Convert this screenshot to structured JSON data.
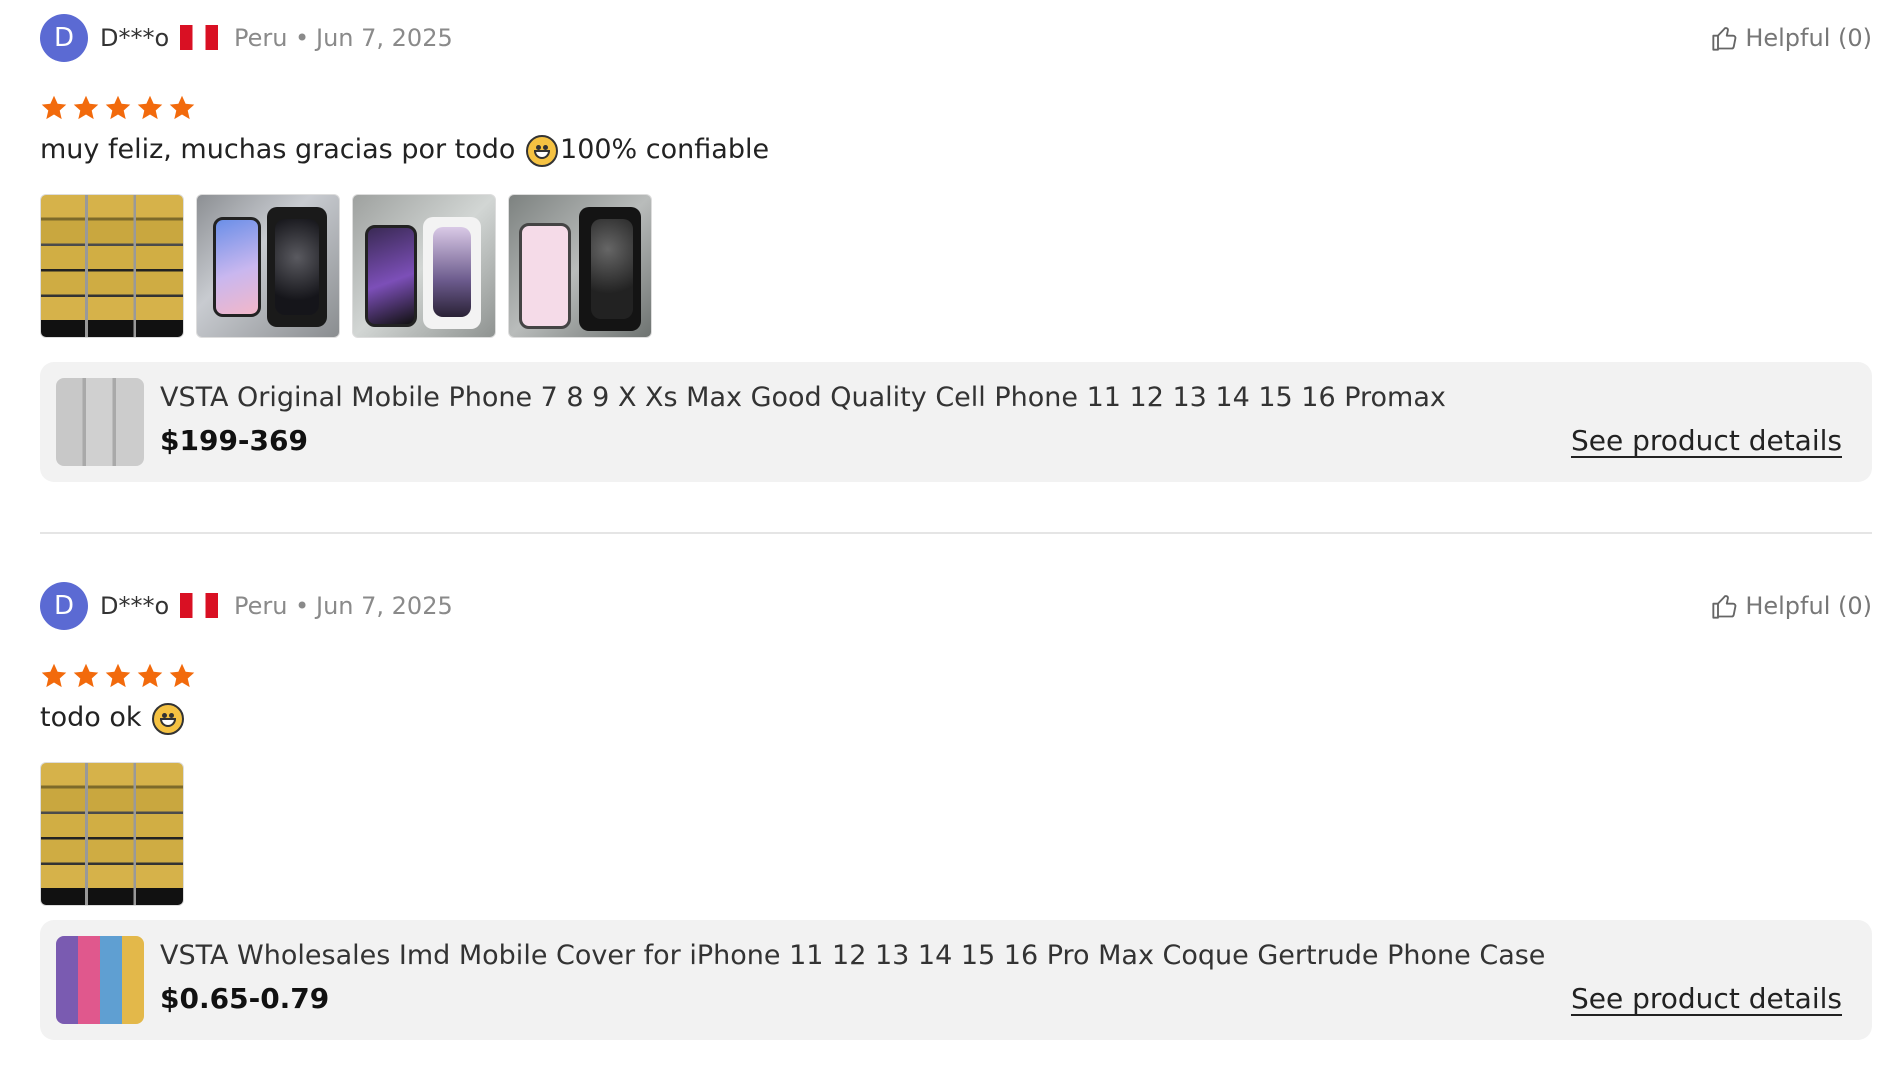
{
  "reviews": [
    {
      "avatar_letter": "D",
      "name": "D***o",
      "country": "Peru",
      "separator": "•",
      "date": "Jun 7, 2025",
      "helpful": "Helpful (0)",
      "rating": 5,
      "text_before": "muy feliz, muchas gracias por todo ",
      "text_after": "100% confiable",
      "emoji": "grinning-face-emoji",
      "photos": [
        "phone-cases-grid",
        "blue-iphone-with-box",
        "purple-iphone-with-box",
        "pink-iphone-with-box"
      ],
      "product": {
        "title": "VSTA Original Mobile Phone 7 8 9 X Xs Max Good Quality Cell Phone 11 12 13 14 15 16 Promax",
        "price": "$199-369",
        "details_link": "See product details"
      }
    },
    {
      "avatar_letter": "D",
      "name": "D***o",
      "country": "Peru",
      "separator": "•",
      "date": "Jun 7, 2025",
      "helpful": "Helpful (0)",
      "rating": 5,
      "text_before": "todo ok ",
      "text_after": "",
      "emoji": "grinning-face-emoji",
      "photos": [
        "phone-cases-grid"
      ],
      "product": {
        "title": "VSTA Wholesales Imd Mobile Cover for iPhone 11 12 13 14 15 16 Pro Max Coque Gertrude Phone Case",
        "price": "$0.65-0.79",
        "details_link": "See product details"
      }
    }
  ],
  "colors": {
    "avatar": "#5b6ad3",
    "star": "#f26a0c",
    "product_card_bg": "#f2f2f2",
    "muted_text": "#8a8a8a"
  }
}
